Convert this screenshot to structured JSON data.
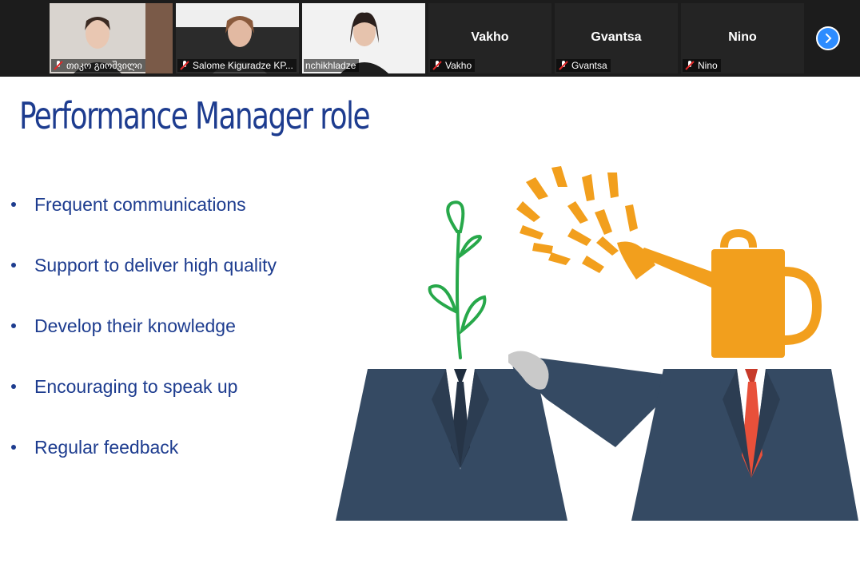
{
  "participants": [
    {
      "name": "თიკო გიოშვილი",
      "video": true,
      "muted": true
    },
    {
      "name": "Salome Kiguradze KP...",
      "video": true,
      "muted": true
    },
    {
      "name": "nchikhladze",
      "video": true,
      "muted": false,
      "active": true
    },
    {
      "name": "Vakho",
      "video": false,
      "muted": true
    },
    {
      "name": "Gvantsa",
      "video": false,
      "muted": true
    },
    {
      "name": "Nino",
      "video": false,
      "muted": true
    }
  ],
  "slide": {
    "title": "Performance Manager role",
    "bullets": [
      "Frequent communications",
      "Support to deliver high quality",
      "Develop their knowledge",
      "Encouraging to speak up",
      "Regular feedback"
    ]
  },
  "colors": {
    "title": "#1d3c8f",
    "suit": "#354a63",
    "plant": "#27a84a",
    "can": "#f29f1d",
    "tie_right": "#e8503a",
    "zoom_blue": "#2d8cff"
  },
  "icons": {
    "muted": "mic-muted-icon",
    "next": "chevron-right-icon"
  }
}
